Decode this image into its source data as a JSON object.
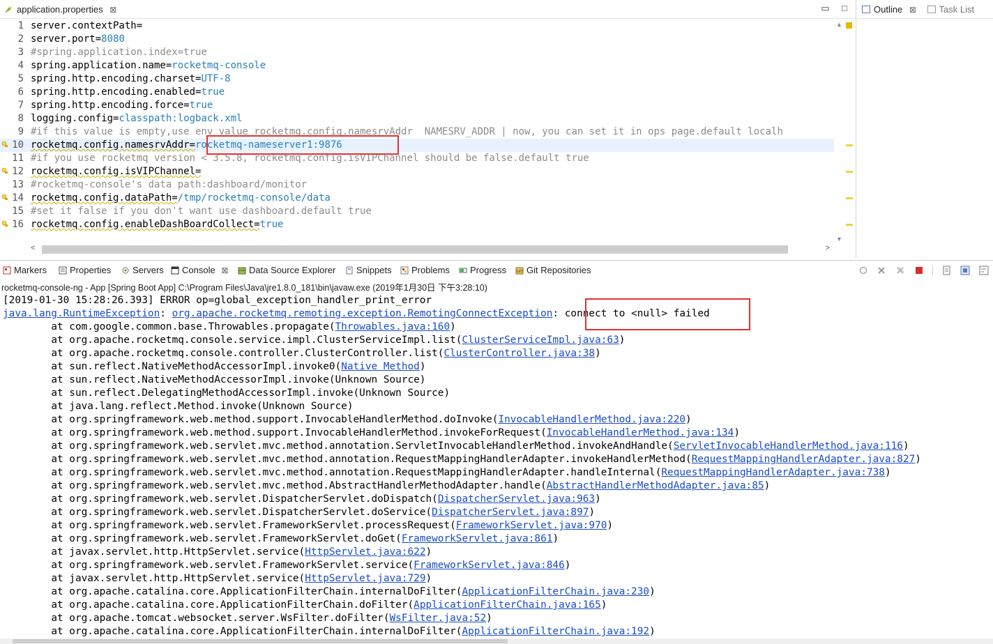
{
  "editor": {
    "tab_title": "application.properties",
    "tab_close": "⊠",
    "minimize": "▭",
    "maximize": "□",
    "lines": [
      {
        "num": "1",
        "key": "server.contextPath=",
        "value": "",
        "type": "kv"
      },
      {
        "num": "2",
        "key": "server.port=",
        "value": "8080",
        "type": "kv"
      },
      {
        "num": "3",
        "comment": "#spring.application.index=true",
        "type": "comment"
      },
      {
        "num": "4",
        "key": "spring.application.name=",
        "value": "rocketmq-console",
        "type": "kv"
      },
      {
        "num": "5",
        "key": "spring.http.encoding.charset=",
        "value": "UTF-8",
        "type": "kv"
      },
      {
        "num": "6",
        "key": "spring.http.encoding.enabled=",
        "value": "true",
        "type": "kv"
      },
      {
        "num": "7",
        "key": "spring.http.encoding.force=",
        "value": "true",
        "type": "kv"
      },
      {
        "num": "8",
        "key": "logging.config=",
        "value": "classpath:logback.xml",
        "type": "kv"
      },
      {
        "num": "9",
        "comment": "#if this value is empty,use env value rocketmq.config.namesrvAddr  NAMESRV_ADDR | now, you can set it in ops page.default localh",
        "type": "comment"
      },
      {
        "num": "10",
        "key": "rocketmq.config.namesrvAddr=",
        "value": "rocketmq-nameserver1:9876",
        "type": "kv",
        "warn": true
      },
      {
        "num": "11",
        "comment": "#if you use rocketmq version < 3.5.8, rocketmq.config.isVIPChannel should be false.default true",
        "type": "comment"
      },
      {
        "num": "12",
        "key": "rocketmq.config.isVIPChannel=",
        "value": "",
        "type": "kv",
        "warn": true
      },
      {
        "num": "13",
        "comment": "#rocketmq-console's data path:dashboard/monitor",
        "type": "comment"
      },
      {
        "num": "14",
        "key": "rocketmq.config.dataPath=",
        "value": "/tmp/rocketmq-console/data",
        "type": "kv",
        "warn": true
      },
      {
        "num": "15",
        "comment": "#set it false if you don't want use dashboard.default true",
        "type": "comment"
      },
      {
        "num": "16",
        "key": "rocketmq.config.enableDashBoardCollect=",
        "value": "true",
        "type": "kv",
        "warn": true
      }
    ]
  },
  "outline": {
    "tab_outline": "Outline",
    "tab_close": "⊠",
    "tab_tasklist": "Task List"
  },
  "views": {
    "markers": "Markers",
    "properties": "Properties",
    "servers": "Servers",
    "console": "Console",
    "console_close": "⊠",
    "data_source": "Data Source Explorer",
    "snippets": "Snippets",
    "problems": "Problems",
    "progress": "Progress",
    "git": "Git Repositories"
  },
  "console": {
    "title": "rocketmq-console-ng - App [Spring Boot App] C:\\Program Files\\Java\\jre1.8.0_181\\bin\\javaw.exe (2019年1月30日 下午3:28:10)",
    "error_line": "[2019-01-30 15:28:26.393] ERROR op=global_exception_handler_print_error",
    "exc_class": "java.lang.RuntimeException",
    "exc_sep": ": ",
    "exc_cause": "org.apache.rocketmq.remoting.exception.RemotingConnectException",
    "exc_colon": ": ",
    "exc_message": "connect to <null> failed",
    "stack": [
      {
        "prefix": "\tat com.google.common.base.Throwables.propagate(",
        "link": "Throwables.java:160",
        "suffix": ")"
      },
      {
        "prefix": "\tat org.apache.rocketmq.console.service.impl.ClusterServiceImpl.list(",
        "link": "ClusterServiceImpl.java:63",
        "suffix": ")"
      },
      {
        "prefix": "\tat org.apache.rocketmq.console.controller.ClusterController.list(",
        "link": "ClusterController.java:38",
        "suffix": ")"
      },
      {
        "prefix": "\tat sun.reflect.NativeMethodAccessorImpl.invoke0(",
        "link": "Native Method",
        "suffix": ")"
      },
      {
        "prefix": "\tat sun.reflect.NativeMethodAccessorImpl.invoke(Unknown Source)",
        "link": "",
        "suffix": ""
      },
      {
        "prefix": "\tat sun.reflect.DelegatingMethodAccessorImpl.invoke(Unknown Source)",
        "link": "",
        "suffix": ""
      },
      {
        "prefix": "\tat java.lang.reflect.Method.invoke(Unknown Source)",
        "link": "",
        "suffix": ""
      },
      {
        "prefix": "\tat org.springframework.web.method.support.InvocableHandlerMethod.doInvoke(",
        "link": "InvocableHandlerMethod.java:220",
        "suffix": ")"
      },
      {
        "prefix": "\tat org.springframework.web.method.support.InvocableHandlerMethod.invokeForRequest(",
        "link": "InvocableHandlerMethod.java:134",
        "suffix": ")"
      },
      {
        "prefix": "\tat org.springframework.web.servlet.mvc.method.annotation.ServletInvocableHandlerMethod.invokeAndHandle(",
        "link": "ServletInvocableHandlerMethod.java:116",
        "suffix": ")"
      },
      {
        "prefix": "\tat org.springframework.web.servlet.mvc.method.annotation.RequestMappingHandlerAdapter.invokeHandlerMethod(",
        "link": "RequestMappingHandlerAdapter.java:827",
        "suffix": ")"
      },
      {
        "prefix": "\tat org.springframework.web.servlet.mvc.method.annotation.RequestMappingHandlerAdapter.handleInternal(",
        "link": "RequestMappingHandlerAdapter.java:738",
        "suffix": ")"
      },
      {
        "prefix": "\tat org.springframework.web.servlet.mvc.method.AbstractHandlerMethodAdapter.handle(",
        "link": "AbstractHandlerMethodAdapter.java:85",
        "suffix": ")"
      },
      {
        "prefix": "\tat org.springframework.web.servlet.DispatcherServlet.doDispatch(",
        "link": "DispatcherServlet.java:963",
        "suffix": ")"
      },
      {
        "prefix": "\tat org.springframework.web.servlet.DispatcherServlet.doService(",
        "link": "DispatcherServlet.java:897",
        "suffix": ")"
      },
      {
        "prefix": "\tat org.springframework.web.servlet.FrameworkServlet.processRequest(",
        "link": "FrameworkServlet.java:970",
        "suffix": ")"
      },
      {
        "prefix": "\tat org.springframework.web.servlet.FrameworkServlet.doGet(",
        "link": "FrameworkServlet.java:861",
        "suffix": ")"
      },
      {
        "prefix": "\tat javax.servlet.http.HttpServlet.service(",
        "link": "HttpServlet.java:622",
        "suffix": ")"
      },
      {
        "prefix": "\tat org.springframework.web.servlet.FrameworkServlet.service(",
        "link": "FrameworkServlet.java:846",
        "suffix": ")"
      },
      {
        "prefix": "\tat javax.servlet.http.HttpServlet.service(",
        "link": "HttpServlet.java:729",
        "suffix": ")"
      },
      {
        "prefix": "\tat org.apache.catalina.core.ApplicationFilterChain.internalDoFilter(",
        "link": "ApplicationFilterChain.java:230",
        "suffix": ")"
      },
      {
        "prefix": "\tat org.apache.catalina.core.ApplicationFilterChain.doFilter(",
        "link": "ApplicationFilterChain.java:165",
        "suffix": ")"
      },
      {
        "prefix": "\tat org.apache.tomcat.websocket.server.WsFilter.doFilter(",
        "link": "WsFilter.java:52",
        "suffix": ")"
      },
      {
        "prefix": "\tat org.apache.catalina.core.ApplicationFilterChain.internalDoFilter(",
        "link": "ApplicationFilterChain.java:192",
        "suffix": ")"
      }
    ]
  },
  "colors": {
    "highlight_box": "#e0312f",
    "link": "#1a4cc4",
    "comment": "#8c8c8c",
    "value": "#2a7fb8",
    "current_line": "#e8f2fe"
  }
}
